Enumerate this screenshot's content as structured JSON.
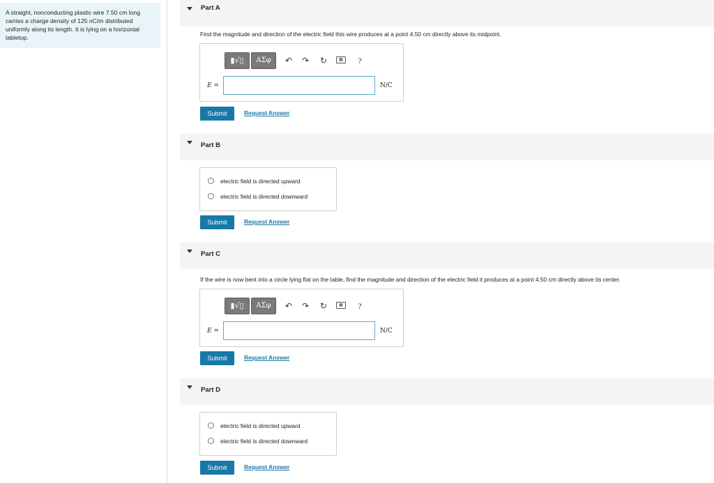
{
  "problem": {
    "text": "A straight, nonconducting plastic wire 7.50 cm long carries a charge density of 125 nC/m distributed uniformly along its length. It is lying on a horizontal tabletop."
  },
  "toolbar": {
    "template_glyph": "▮√▯",
    "greek_label": "ΑΣφ",
    "help_label": "?"
  },
  "parts": [
    {
      "title": "Part A",
      "question": "Find the magnitude and direction of the electric field this wire produces at a point 4.50 cm directly above its midpoint.",
      "eq_label": "E =",
      "input_value": "",
      "unit": "N/C",
      "submit": "Submit",
      "request": "Request Answer"
    },
    {
      "title": "Part B",
      "options": [
        "electric field is directed upward",
        "electric field is directed downward"
      ],
      "submit": "Submit",
      "request": "Request Answer"
    },
    {
      "title": "Part C",
      "question": "If the wire is now bent into a circle lying flat on the table, find the magnitude and direction of the electric field it produces at a point 4.50 cm directly above its center.",
      "eq_label": "E =",
      "input_value": "",
      "unit": "N/C",
      "submit": "Submit",
      "request": "Request Answer"
    },
    {
      "title": "Part D",
      "options": [
        "electric field is directed upward",
        "electric field is directed downward"
      ],
      "submit": "Submit",
      "request": "Request Answer"
    }
  ],
  "colors": {
    "accent": "#1779a7",
    "problem_bg": "#e8f4f8",
    "header_bg": "#f4f4f4",
    "toolbar_btn": "#7a7a7a"
  },
  "icons": [
    "undo-icon",
    "redo-icon",
    "reset-icon",
    "keyboard-icon",
    "help-icon",
    "collapse-triangle-icon",
    "template-icon",
    "greek-symbols-icon"
  ]
}
